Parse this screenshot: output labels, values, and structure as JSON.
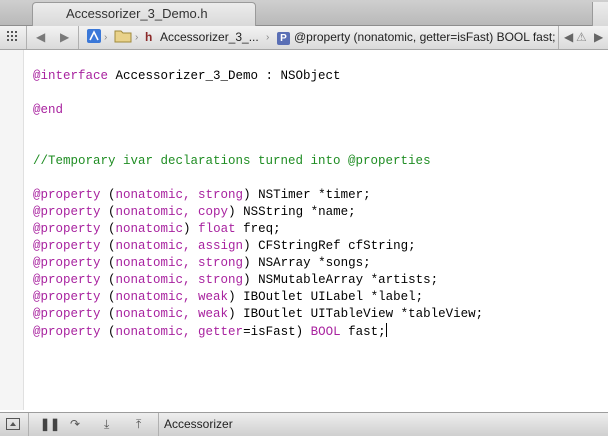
{
  "tab": {
    "title": "Accessorizer_3_Demo.h"
  },
  "jumpbar": {
    "file_label": "Accessorizer_3_...",
    "file_icon_letter": "h",
    "symbol_icon_letter": "P",
    "symbol_label": "@property (nonatomic, getter=isFast) BOOL fast;"
  },
  "code": {
    "l1a": "@interface",
    "l1b": " Accessorizer_3_Demo : NSObject",
    "l2": "@end",
    "l3": "//Temporary ivar declarations turned into @properties",
    "properties": [
      {
        "kw": "@property",
        "open": " (",
        "mods": "nonatomic, strong",
        "close": ") ",
        "type": "NSTimer",
        "rest": " *timer;"
      },
      {
        "kw": "@property",
        "open": " (",
        "mods": "nonatomic, copy",
        "close": ") ",
        "type": "NSString",
        "rest": " *name;"
      },
      {
        "kw": "@property",
        "open": " (",
        "mods": "nonatomic",
        "close": ") ",
        "type": "float",
        "rest": " freq;"
      },
      {
        "kw": "@property",
        "open": " (",
        "mods": "nonatomic, assign",
        "close": ") ",
        "type": "CFStringRef",
        "rest": " cfString;"
      },
      {
        "kw": "@property",
        "open": " (",
        "mods": "nonatomic, strong",
        "close": ") ",
        "type": "NSArray",
        "rest": " *songs;"
      },
      {
        "kw": "@property",
        "open": " (",
        "mods": "nonatomic, strong",
        "close": ") ",
        "type": "NSMutableArray",
        "rest": " *artists;"
      },
      {
        "kw": "@property",
        "open": " (",
        "mods": "nonatomic, weak",
        "close": ") ",
        "type": "IBOutlet UILabel",
        "rest": " *label;"
      },
      {
        "kw": "@property",
        "open": " (",
        "mods": "nonatomic, weak",
        "close": ") ",
        "type": "IBOutlet UITableView",
        "rest": " *tableView;"
      },
      {
        "kw": "@property",
        "open": " (",
        "mods": "nonatomic, getter",
        "close": "=isFast) ",
        "type": "BOOL",
        "rest": " fast;"
      }
    ]
  },
  "bottombar": {
    "target_label": "Accessorizer"
  },
  "colors": {
    "keyword": "#a8229f",
    "comment": "#1f8d23"
  }
}
